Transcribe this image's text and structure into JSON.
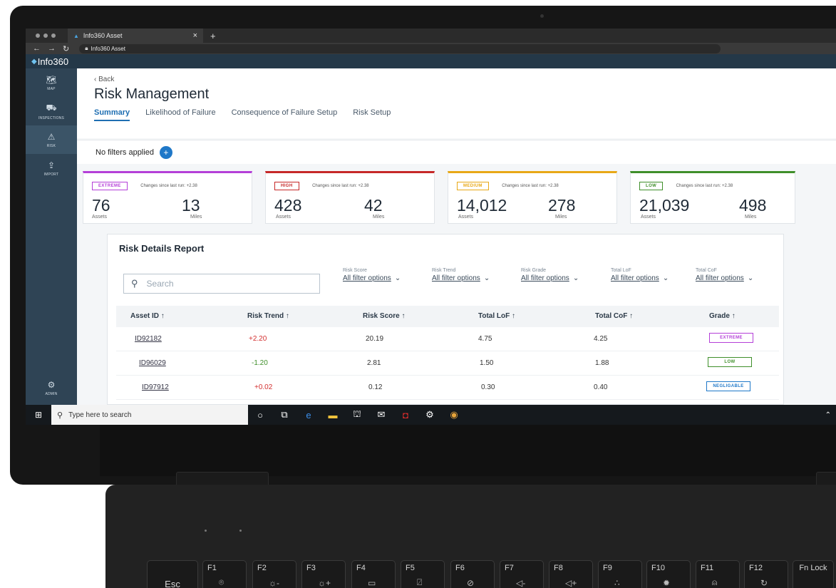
{
  "browser": {
    "tab_title": "Info360 Asset",
    "tab_close": "×",
    "new_tab": "+",
    "url": "Info360 Asset"
  },
  "app": {
    "brand": "Info360"
  },
  "sidebar": {
    "items": [
      {
        "icon": "map-icon",
        "label": "MAP"
      },
      {
        "icon": "inspections-icon",
        "label": "INSPECTIONS"
      },
      {
        "icon": "risk-icon",
        "label": "RISK"
      },
      {
        "icon": "import-icon",
        "label": "IMPORT"
      }
    ],
    "bottom": {
      "icon": "admin-icon",
      "label": "ADMIN"
    }
  },
  "page": {
    "back": "Back",
    "title": "Risk Management",
    "tabs": [
      "Summary",
      "Likelihood of Failure",
      "Consequence of Failure Setup",
      "Risk Setup"
    ],
    "active_tab": "Summary",
    "filters_text": "No filters applied",
    "add_filter": "+"
  },
  "cards": [
    {
      "grade": "EXTREME",
      "since": "Changes since last run: +2.38",
      "assets": "76",
      "assets_label": "Assets",
      "miles": "13",
      "miles_label": "Miles",
      "color": "#b43fd8"
    },
    {
      "grade": "HIGH",
      "since": "Changes since last run: +2.38",
      "assets": "428",
      "assets_label": "Assets",
      "miles": "42",
      "miles_label": "Miles",
      "color": "#c62828"
    },
    {
      "grade": "MEDIUM",
      "since": "Changes since last run: +2.38",
      "assets": "14,012",
      "assets_label": "Assets",
      "miles": "278",
      "miles_label": "Miles",
      "color": "#e8a817"
    },
    {
      "grade": "LOW",
      "since": "Changes since last run: +2.38",
      "assets": "21,039",
      "assets_label": "Assets",
      "miles": "498",
      "miles_label": "Miles",
      "color": "#3f8f2a"
    }
  ],
  "report": {
    "title": "Risk Details Report",
    "search_placeholder": "Search",
    "filters": [
      {
        "label": "Risk Score",
        "value": "All filter options"
      },
      {
        "label": "Risk Trend",
        "value": "All filter options"
      },
      {
        "label": "Risk Grade",
        "value": "All filter options"
      },
      {
        "label": "Total LoF",
        "value": "All filter options"
      },
      {
        "label": "Total CoF",
        "value": "All filter options"
      }
    ],
    "columns": [
      "Asset ID",
      "Risk Trend",
      "Risk Score",
      "Total LoF",
      "Total CoF",
      "Grade"
    ],
    "sort_icon": "↑",
    "rows": [
      {
        "id": "ID92182",
        "trend": "+2.20",
        "score": "20.19",
        "lof": "4.75",
        "cof": "4.25",
        "grade": "EXTREME",
        "trend_color": "#d32f2f",
        "grade_color": "#b43fd8"
      },
      {
        "id": "ID96029",
        "trend": "-1.20",
        "score": "2.81",
        "lof": "1.50",
        "cof": "1.88",
        "grade": "LOW",
        "trend_color": "#3f8f2a",
        "grade_color": "#3f8f2a"
      },
      {
        "id": "ID97912",
        "trend": "+0.02",
        "score": "0.12",
        "lof": "0.30",
        "cof": "0.40",
        "grade": "NEGLIGABLE",
        "trend_color": "#d32f2f",
        "grade_color": "#1f78c8"
      }
    ]
  },
  "taskbar": {
    "search_placeholder": "Type here to search",
    "icons": [
      "cortana-icon",
      "task-view-icon",
      "edge-icon",
      "file-explorer-icon",
      "store-icon",
      "mail-icon",
      "mcafee-icon",
      "settings-icon",
      "chrome-icon"
    ]
  },
  "keyboard": {
    "keys": [
      {
        "label": "Esc"
      },
      {
        "label": "F1",
        "icon": "⌾"
      },
      {
        "label": "F2",
        "icon": "☼-"
      },
      {
        "label": "F3",
        "icon": "☼+"
      },
      {
        "label": "F4",
        "icon": "▭"
      },
      {
        "label": "F5",
        "icon": "⍁"
      },
      {
        "label": "F6",
        "icon": "⊘"
      },
      {
        "label": "F7",
        "icon": "◁-"
      },
      {
        "label": "F8",
        "icon": "◁+"
      },
      {
        "label": "F9",
        "icon": "∴"
      },
      {
        "label": "F10",
        "icon": "✹"
      },
      {
        "label": "F11",
        "icon": "⍝"
      },
      {
        "label": "F12",
        "icon": "↻"
      },
      {
        "label": "Fn Lock"
      }
    ]
  }
}
